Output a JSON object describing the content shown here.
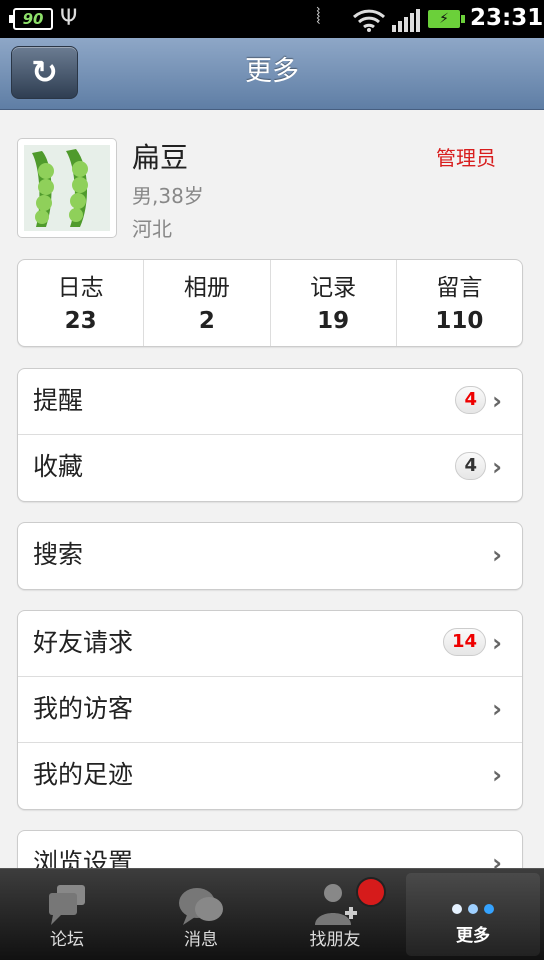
{
  "status_bar": {
    "battery_small": "90",
    "time": "23:31"
  },
  "title_bar": {
    "title": "更多",
    "refresh_icon": "refresh-icon"
  },
  "profile": {
    "name": "扁豆",
    "info": "男,38岁",
    "location": "河北",
    "role": "管理员"
  },
  "stats": [
    {
      "label": "日志",
      "value": "23"
    },
    {
      "label": "相册",
      "value": "2"
    },
    {
      "label": "记录",
      "value": "19"
    },
    {
      "label": "留言",
      "value": "110"
    }
  ],
  "menu": {
    "reminders": {
      "label": "提醒",
      "badge": "4"
    },
    "favorites": {
      "label": "收藏",
      "badge": "4"
    },
    "search": {
      "label": "搜索"
    },
    "friend_requests": {
      "label": "好友请求",
      "badge": "14"
    },
    "visitors": {
      "label": "我的访客"
    },
    "footprints": {
      "label": "我的足迹"
    },
    "browse_settings": {
      "label": "浏览设置"
    }
  },
  "tabs": [
    {
      "label": "论坛",
      "icon": "forum-icon"
    },
    {
      "label": "消息",
      "icon": "messages-icon"
    },
    {
      "label": "找朋友",
      "icon": "find-friends-icon"
    },
    {
      "label": "更多",
      "icon": "more-icon",
      "active": true
    }
  ],
  "colors": {
    "accent_red": "#d81e1e",
    "title_bar": "#6f8cb3",
    "page_bg": "#f2f2f2"
  }
}
